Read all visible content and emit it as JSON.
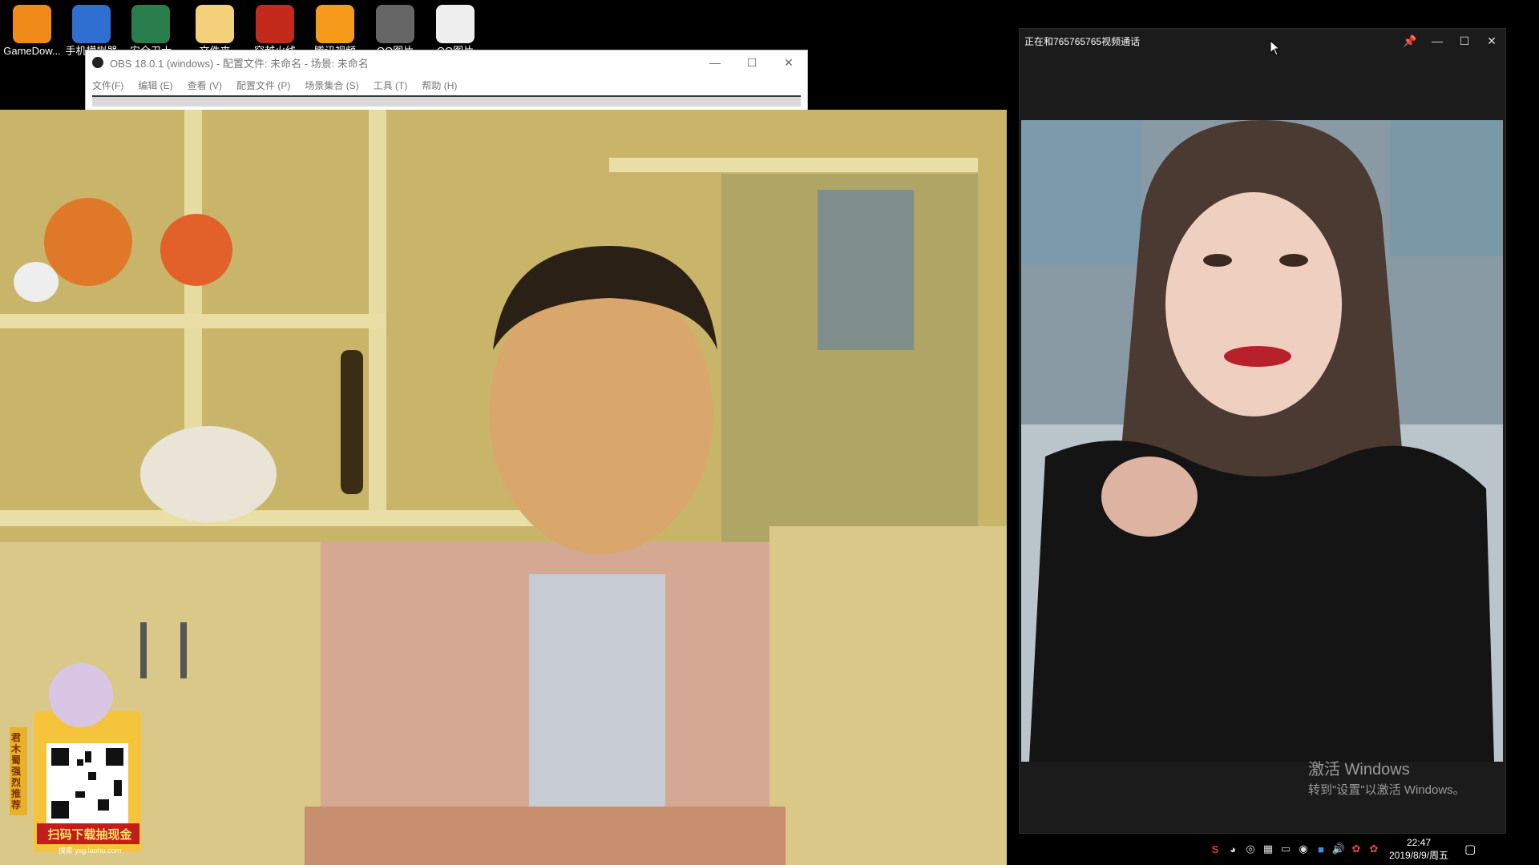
{
  "desktop": {
    "icons": [
      {
        "label": "GameDow...",
        "icon": "gamedownloader-icon",
        "color": "#f08a18"
      },
      {
        "label": "手机模拟器",
        "icon": "phone-emulator-icon",
        "color": "#2f6fd1"
      },
      {
        "label": "安全卫士",
        "icon": "security-shield-icon",
        "color": "#2a7d4c"
      },
      {
        "label": "文件夹",
        "icon": "folder-icon",
        "color": "#f2d17a"
      },
      {
        "label": "穿越火线",
        "icon": "crossfire-icon",
        "color": "#c32a1c"
      },
      {
        "label": "腾讯视频",
        "icon": "video-player-icon",
        "color": "#f59a1b"
      },
      {
        "label": "QQ图片",
        "icon": "qr-image-icon",
        "color": "#666"
      },
      {
        "label": "QQ图片",
        "icon": "image-file-icon",
        "color": "#eee"
      }
    ]
  },
  "obs": {
    "title": "OBS 18.0.1 (windows) - 配置文件: 未命名 - 场景: 未命名",
    "menu": [
      "文件(F)",
      "编辑 (E)",
      "查看 (V)",
      "配置文件 (P)",
      "场景集合 (S)",
      "工具 (T)",
      "帮助 (H)"
    ],
    "buttons": {
      "minimize": "—",
      "maximize": "☐",
      "close": "✕"
    }
  },
  "call": {
    "title": "正在和765765765视频通话",
    "buttons": {
      "pin": "📌",
      "minimize": "—",
      "maximize": "☐",
      "close": "✕"
    }
  },
  "watermark": {
    "line1": "激活 Windows",
    "line2": "转到\"设置\"以激活 Windows。"
  },
  "ad": {
    "banner": "扫码下载抽现金",
    "site": "搜索 ysg.laohu.com",
    "side": "君木蜀强烈推荐"
  },
  "tray": {
    "time": "22:47",
    "date": "2019/8/9/周五"
  }
}
